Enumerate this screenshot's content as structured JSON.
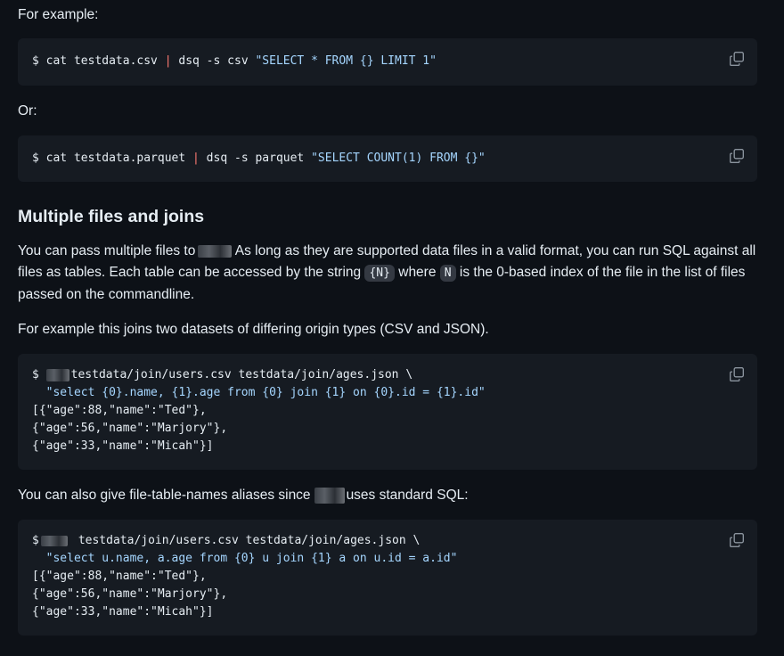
{
  "p1": "For example:",
  "code1": {
    "prompt": "$ ",
    "cmd1": "cat testdata.csv ",
    "pipe": "|",
    "cmd2": " dsq -s csv ",
    "str": "\"SELECT * FROM {} LIMIT 1\""
  },
  "p2": "Or:",
  "code2": {
    "prompt": "$ ",
    "cmd1": "cat testdata.parquet ",
    "pipe": "|",
    "cmd2": " dsq -s parquet ",
    "str": "\"SELECT COUNT(1) FROM {}\""
  },
  "heading": "Multiple files and joins",
  "p3": {
    "a": "You can pass multiple files to",
    "b": " As long as they are supported data files in a valid format, you can run SQL against all files as tables. Each table can be accessed by the string ",
    "code_n": "{N}",
    "c": " where ",
    "code_nn": "N",
    "d": " is the 0-based index of the file in the list of files passed on the commandline."
  },
  "p4": "For example this joins two datasets of differing origin types (CSV and JSON).",
  "code3": {
    "l1_prompt": "$ ",
    "l1_cmd": "testdata/join/users.csv testdata/join/ages.json \\",
    "l2": "  \"select {0}.name, {1}.age from {0} join {1} on {0}.id = {1}.id\"",
    "l3": "[{\"age\":88,\"name\":\"Ted\"},",
    "l4": "{\"age\":56,\"name\":\"Marjory\"},",
    "l5": "{\"age\":33,\"name\":\"Micah\"}]"
  },
  "p5": {
    "a": "You can also give file-table-names aliases since",
    "b": "uses standard SQL:"
  },
  "code4": {
    "l1_prompt": "$",
    "l1_cmd": "testdata/join/users.csv testdata/join/ages.json \\",
    "l2": "  \"select u.name, a.age from {0} u join {1} a on u.id = a.id\"",
    "l3": "[{\"age\":88,\"name\":\"Ted\"},",
    "l4": "{\"age\":56,\"name\":\"Marjory\"},",
    "l5": "{\"age\":33,\"name\":\"Micah\"}]"
  },
  "icons": {
    "copy": "copy-icon"
  },
  "colors": {
    "background": "#0d1117",
    "code_bg": "#161b22",
    "string": "#a5d6ff",
    "pipe": "#ff7b72"
  }
}
